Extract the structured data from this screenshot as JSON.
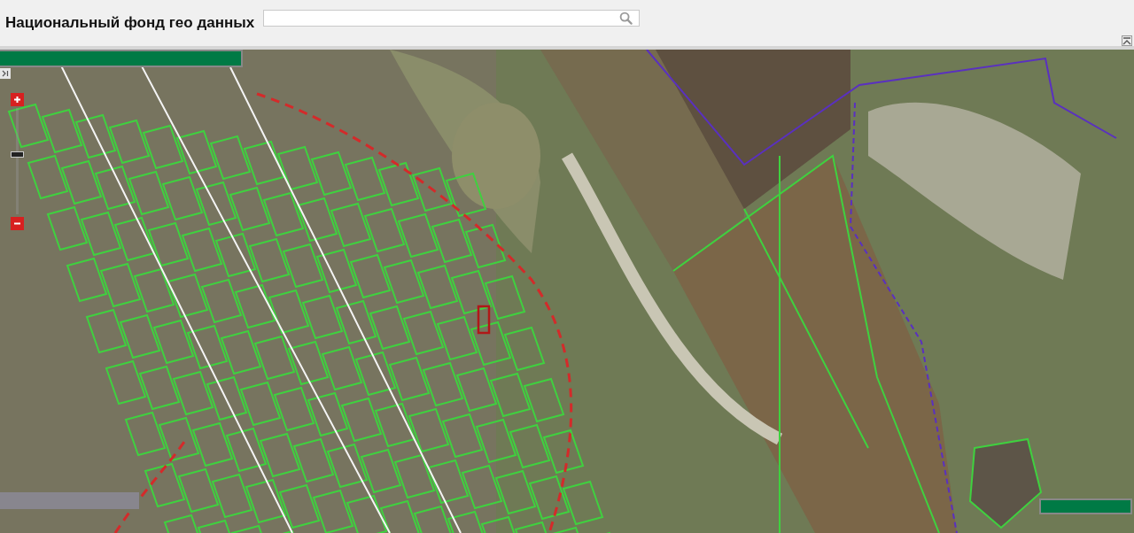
{
  "header": {
    "title": "Национальный фонд гео данных"
  },
  "map": {
    "zoom_slider": {
      "level": 0.56
    }
  }
}
